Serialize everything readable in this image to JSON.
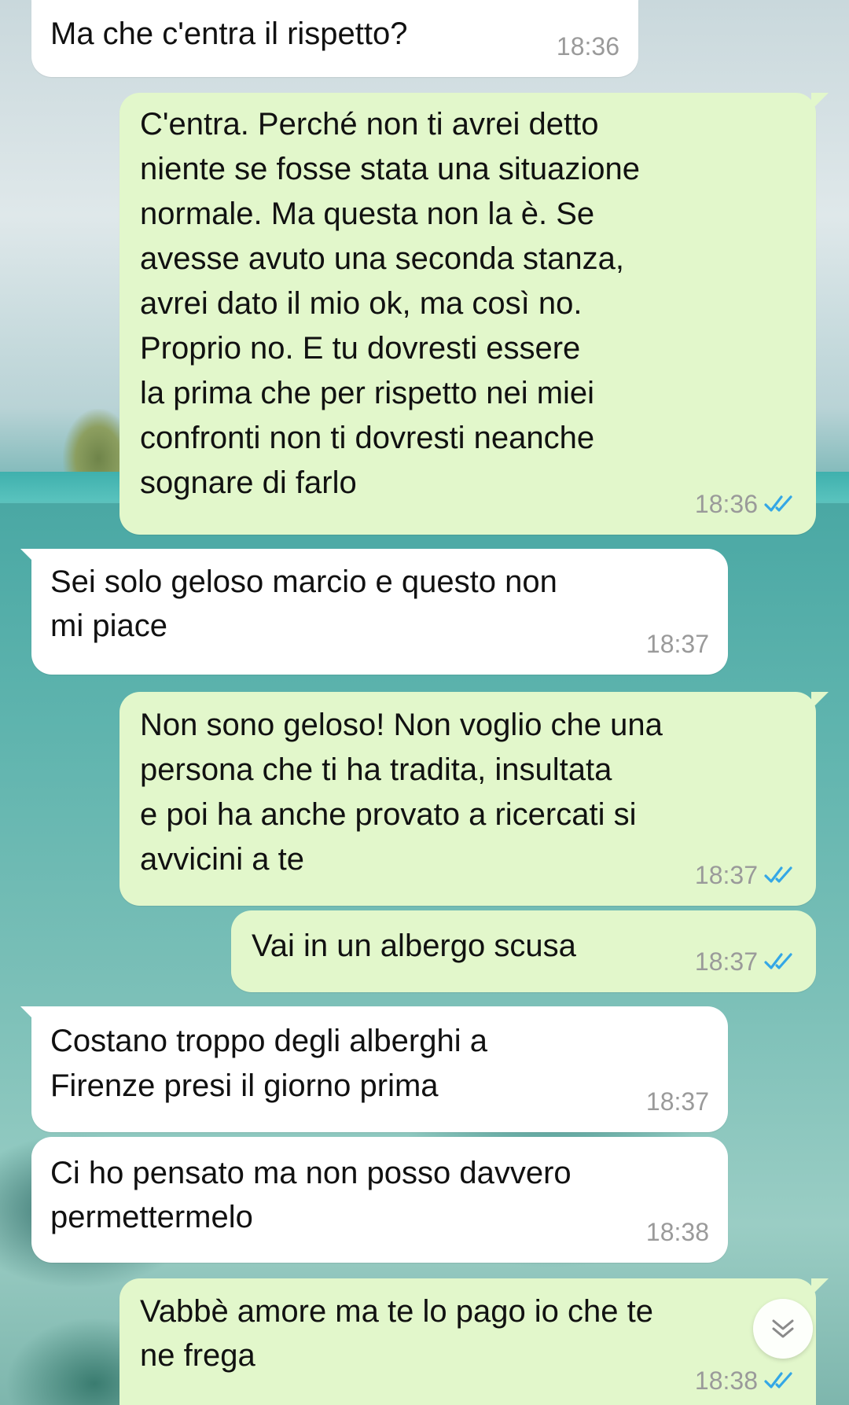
{
  "messages": [
    {
      "direction": "in",
      "text": "Ma che c'entra il rispetto?",
      "time": "18:36"
    },
    {
      "direction": "out",
      "text": "C'entra. Perché non ti avrei detto\nniente se fosse stata una situazione\nnormale. Ma questa non la è. Se\navesse avuto una seconda stanza,\navrei dato il mio ok, ma così no.\nProprio no. E tu dovresti essere\nla prima che per rispetto nei miei\nconfronti non ti dovresti neanche\nsognare di farlo",
      "time": "18:36",
      "status": "read"
    },
    {
      "direction": "in",
      "text": "Sei solo geloso marcio e questo non\nmi piace",
      "time": "18:37"
    },
    {
      "direction": "out",
      "text": "Non sono geloso! Non voglio che una\npersona che ti ha tradita, insultata\ne poi ha anche provato a ricercati si\navvicini a te",
      "time": "18:37",
      "status": "read"
    },
    {
      "direction": "out",
      "text": "Vai in un albergo scusa",
      "time": "18:37",
      "status": "read"
    },
    {
      "direction": "in",
      "text": "Costano troppo degli alberghi a\nFirenze presi il giorno prima",
      "time": "18:37"
    },
    {
      "direction": "in",
      "text": "Ci ho pensato ma non posso davvero\npermettermelo",
      "time": "18:38"
    },
    {
      "direction": "out",
      "text": "Vabbè amore ma te lo pago io che te\nne frega",
      "time": "18:38",
      "status": "read"
    }
  ],
  "colors": {
    "incoming_bubble": "#ffffff",
    "outgoing_bubble": "#e2f7cb",
    "read_check": "#34a7e6",
    "timestamp": "#9a9a9a"
  },
  "icons": {
    "read_receipt": "double-check-icon",
    "scroll_down": "chevron-down-icon"
  }
}
